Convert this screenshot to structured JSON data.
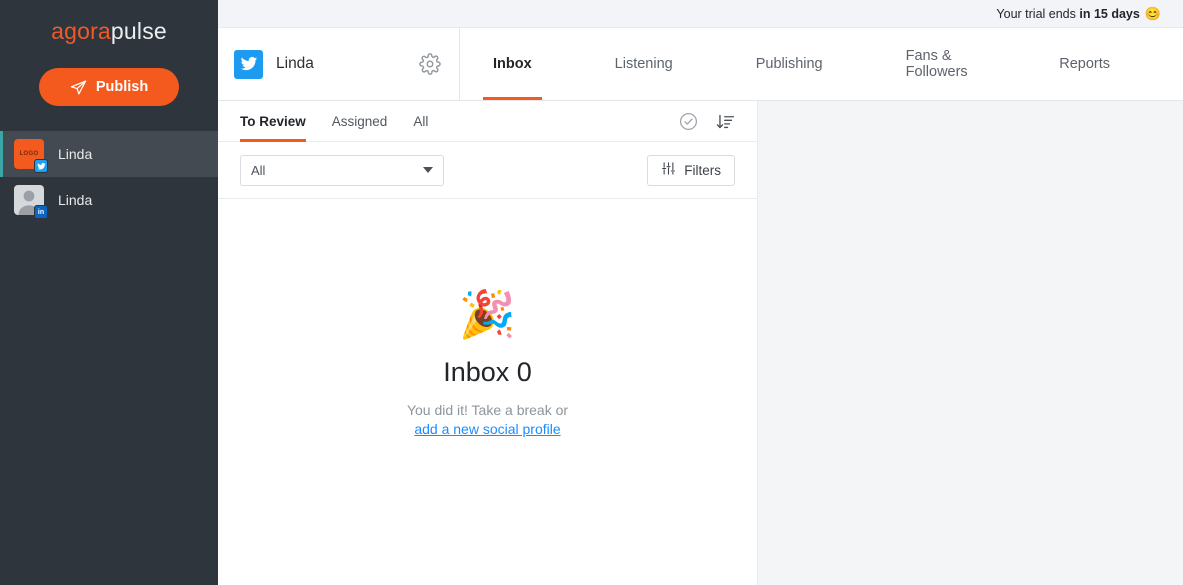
{
  "sidebar": {
    "brand": {
      "part1": "agora",
      "part2": "pulse"
    },
    "publish_label": "Publish",
    "profiles": [
      {
        "name": "Linda",
        "avatar_text": "LOGO",
        "network": "twitter",
        "badge_text": "",
        "active": true
      },
      {
        "name": "Linda",
        "avatar_text": "",
        "network": "linkedin",
        "badge_text": "in",
        "active": false
      }
    ]
  },
  "trial": {
    "prefix": "Your trial ends ",
    "bold": "in 15 days",
    "emoji": "😊"
  },
  "header": {
    "profile_name": "Linda",
    "tabs": [
      {
        "label": "Inbox",
        "active": true
      },
      {
        "label": "Listening",
        "active": false
      },
      {
        "label": "Publishing",
        "active": false
      },
      {
        "label": "Fans & Followers",
        "active": false
      },
      {
        "label": "Reports",
        "active": false
      }
    ]
  },
  "inbox": {
    "subtabs": [
      {
        "label": "To Review",
        "active": true
      },
      {
        "label": "Assigned",
        "active": false
      },
      {
        "label": "All",
        "active": false
      }
    ],
    "select_value": "All",
    "filters_label": "Filters",
    "empty": {
      "emoji": "🎉",
      "title": "Inbox 0",
      "subtitle": "You did it! Take a break or",
      "link": "add a new social profile"
    }
  },
  "colors": {
    "brand_orange": "#f4591d",
    "sidebar_bg": "#2f353d",
    "link_blue": "#1a8cff",
    "twitter_blue": "#1d9bf0",
    "linkedin_blue": "#0a66c2",
    "accent_teal": "#3aa6a6"
  }
}
